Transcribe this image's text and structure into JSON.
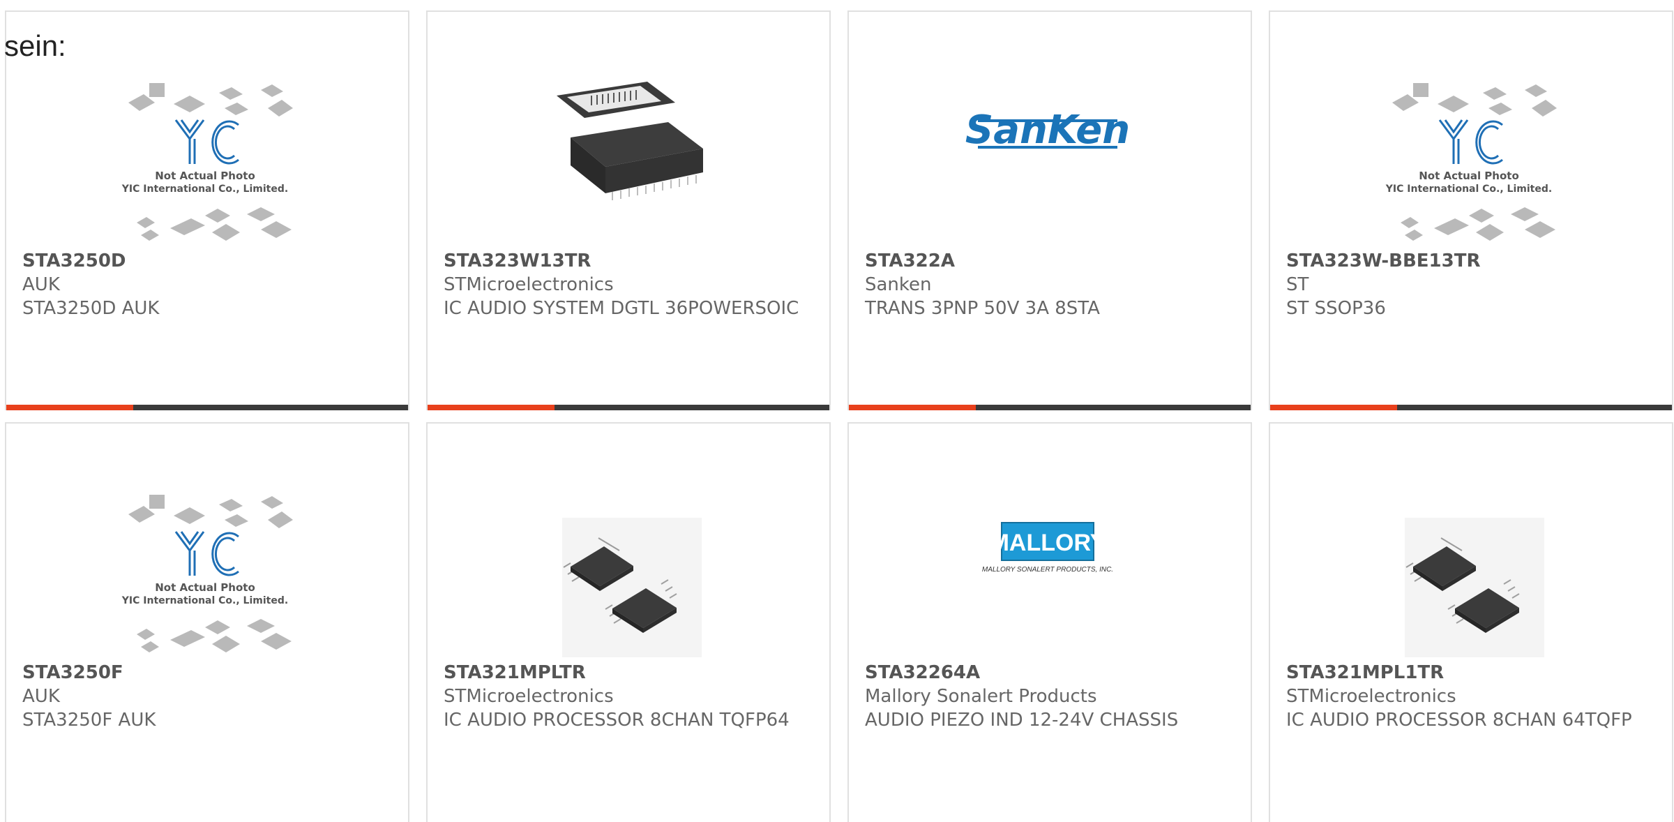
{
  "intro_text": "sein:",
  "colors": {
    "accent": "#e8401c",
    "bar": "#3a3a3a",
    "border": "#e0e0e0",
    "text": "#666666"
  },
  "products": [
    {
      "part": "STA3250D",
      "maker": "AUK",
      "desc": "STA3250D AUK",
      "image": "yic-placeholder",
      "placeholder": {
        "line1": "Not Actual Photo",
        "line2": "YIC International Co., Limited.",
        "logo": "YIC"
      }
    },
    {
      "part": "STA323W13TR",
      "maker": "STMicroelectronics",
      "desc": "IC AUDIO SYSTEM DGTL 36POWERSOIC",
      "image": "powersoic-package"
    },
    {
      "part": "STA322A",
      "maker": "Sanken",
      "desc": "TRANS 3PNP 50V 3A 8STA",
      "image": "sanken-logo",
      "logo_text": "SanKen"
    },
    {
      "part": "STA323W-BBE13TR",
      "maker": "ST",
      "desc": "ST SSOP36",
      "image": "yic-placeholder",
      "placeholder": {
        "line1": "Not Actual Photo",
        "line2": "YIC International Co., Limited.",
        "logo": "YIC"
      }
    },
    {
      "part": "STA3250F",
      "maker": "AUK",
      "desc": "STA3250F AUK",
      "image": "yic-placeholder",
      "placeholder": {
        "line1": "Not Actual Photo",
        "line2": "YIC International Co., Limited.",
        "logo": "YIC"
      }
    },
    {
      "part": "STA321MPLTR",
      "maker": "STMicroelectronics",
      "desc": "IC AUDIO PROCESSOR 8CHAN TQFP64",
      "image": "tqfp-chips"
    },
    {
      "part": "STA32264A",
      "maker": "Mallory Sonalert Products",
      "desc": "AUDIO PIEZO IND 12-24V CHASSIS",
      "image": "mallory-logo",
      "logo_text": "MALLORY",
      "logo_sub": "MALLORY SONALERT PRODUCTS, INC."
    },
    {
      "part": "STA321MPL1TR",
      "maker": "STMicroelectronics",
      "desc": "IC AUDIO PROCESSOR 8CHAN 64TQFP",
      "image": "tqfp-chips"
    }
  ]
}
